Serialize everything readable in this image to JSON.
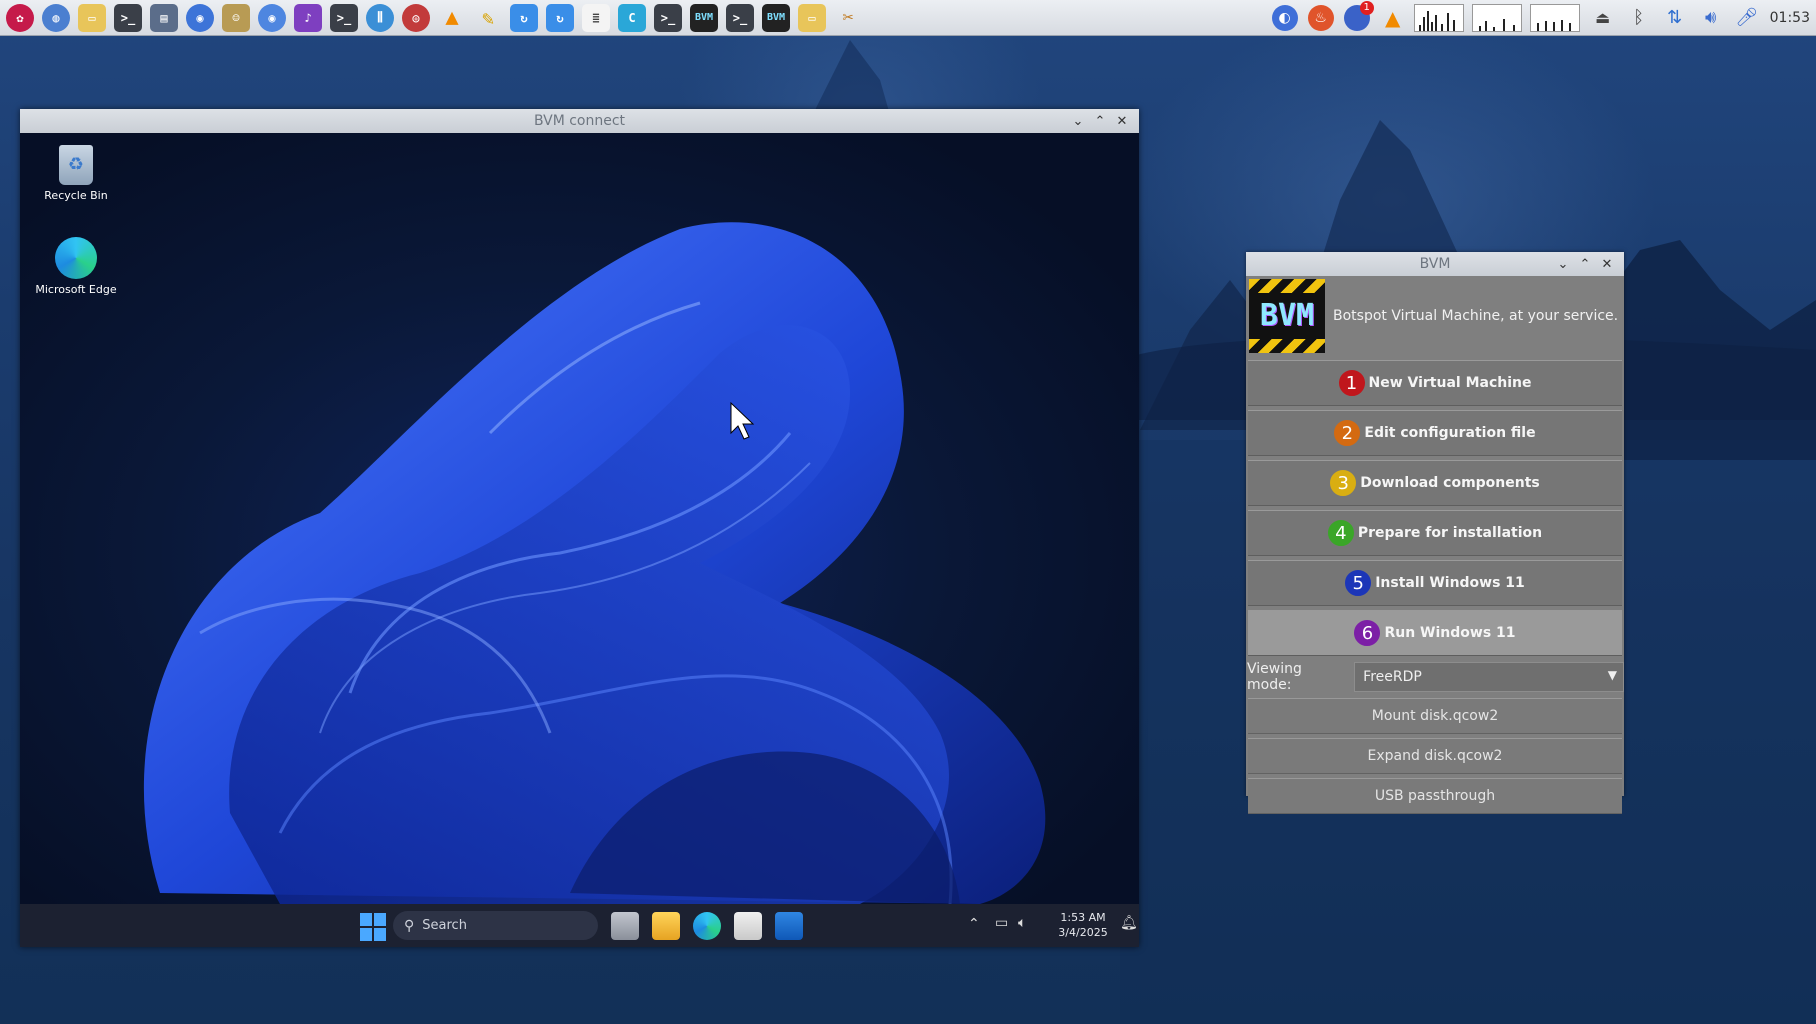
{
  "panel": {
    "clock": "01:53",
    "launcher_icons": [
      "raspberry-menu-icon",
      "globe-icon",
      "folder-icon",
      "terminal-icon",
      "task-manager-icon",
      "chromium-icon",
      "gimp-icon",
      "chromium-icon",
      "pi-apps-icon",
      "terminal-icon",
      "audio-mixer-icon",
      "cd-icon",
      "vlc-icon",
      "pencil-icon",
      "refresh-icon",
      "refresh-icon",
      "document-icon",
      "c-icon",
      "terminal-icon",
      "bvm-icon",
      "terminal-icon",
      "bvm-icon",
      "folder-icon",
      "tools-icon"
    ],
    "badge_count": "1"
  },
  "bvm_connect": {
    "title": "BVM connect",
    "desktop_icons": [
      {
        "label": "Recycle Bin"
      },
      {
        "label": "Microsoft Edge"
      }
    ],
    "taskbar": {
      "search_placeholder": "Search",
      "time": "1:53 AM",
      "date": "3/4/2025"
    }
  },
  "bvm": {
    "title": "BVM",
    "logo_text": "BVM",
    "tagline": "Botspot Virtual Machine, at your service.",
    "steps": [
      {
        "num": "1",
        "label": "New Virtual Machine",
        "color": "#c0161c"
      },
      {
        "num": "2",
        "label": "Edit configuration file",
        "color": "#d46a11"
      },
      {
        "num": "3",
        "label": "Download components",
        "color": "#d9ae12"
      },
      {
        "num": "4",
        "label": "Prepare for installation",
        "color": "#3aa628"
      },
      {
        "num": "5",
        "label": "Install Windows 11",
        "color": "#1c36b8"
      },
      {
        "num": "6",
        "label": "Run Windows 11",
        "color": "#7c1fa6"
      }
    ],
    "viewing_mode_label": "Viewing mode:",
    "viewing_mode_value": "FreeRDP",
    "extra_buttons": [
      "Mount disk.qcow2",
      "Expand disk.qcow2",
      "USB passthrough"
    ]
  }
}
